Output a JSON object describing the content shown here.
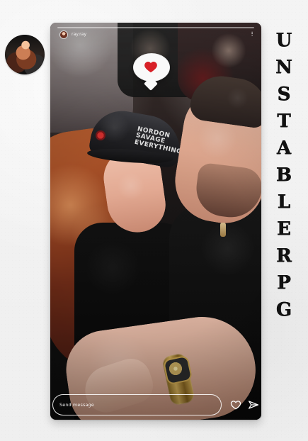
{
  "brand": {
    "letters": [
      "U",
      "N",
      "S",
      "T",
      "A",
      "B",
      "L",
      "E",
      "R",
      "P",
      "G"
    ]
  },
  "story": {
    "username": "ray.ray",
    "more_label": "...",
    "message_placeholder": "Send message"
  },
  "colors": {
    "accent_heart": "#d82027",
    "text_dark": "#121212",
    "text_light": "#ffffff"
  },
  "icons": {
    "avatar": "profile-avatar",
    "reaction": "heart-icon",
    "like": "heart-outline-icon",
    "share": "paper-plane-icon",
    "more": "more-vertical-icon"
  }
}
